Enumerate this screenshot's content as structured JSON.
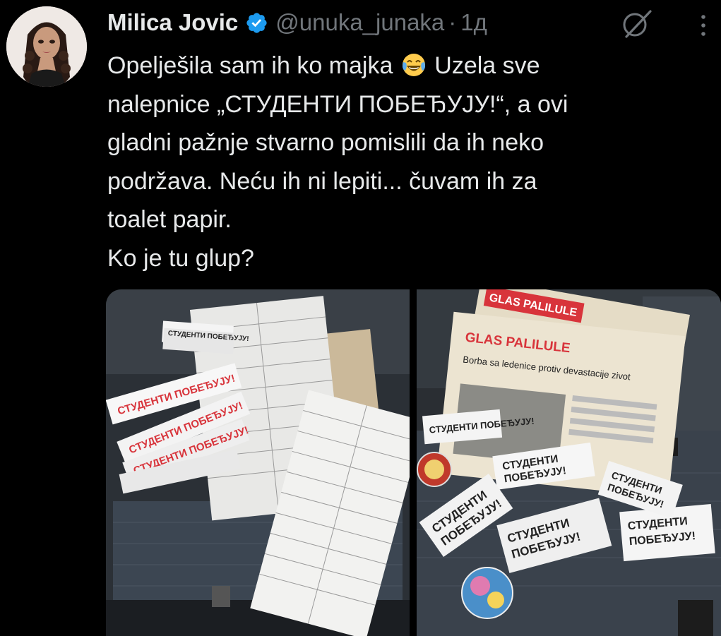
{
  "tweet": {
    "author_name": "Milica Jovic",
    "handle": "@unuka_junaka",
    "separator": "·",
    "time": "1д",
    "text_line1_before_emoji": "Opelješila sam ih ko majka ",
    "text_line1_after_emoji": " Uzela sve",
    "text_rest": "nalepnice „СТУДЕНТИ ПОБЕЂУЈУ!“, a ovi\ngladni pažnje stvarno pomislili da ih neko\npodržava. Neću ih ni lepiti... čuvam ih za\ntoalet papir.\nKo je tu glup?",
    "emoji": "face-with-tears-of-joy"
  },
  "photos": {
    "left": {
      "sticker_text": "СТУДЕНТИ ПОБЕЂУЈУ!"
    },
    "right": {
      "newspaper_title": "GLAS PALILULE",
      "newspaper_headline": "Borba sa ledenice protiv devastacije zivot",
      "sticker_line1": "СТУДЕНТИ",
      "sticker_line2": "ПОБЕЂУЈУ!"
    }
  },
  "icons": {
    "verified": "verified-badge-icon",
    "grok": "grok-icon",
    "more": "more-vertical-icon"
  },
  "colors": {
    "background": "#000000",
    "text": "#e7e9ea",
    "secondary": "#71767b",
    "verified_blue": "#1d9bf0",
    "sticker_red": "#d8343b"
  }
}
